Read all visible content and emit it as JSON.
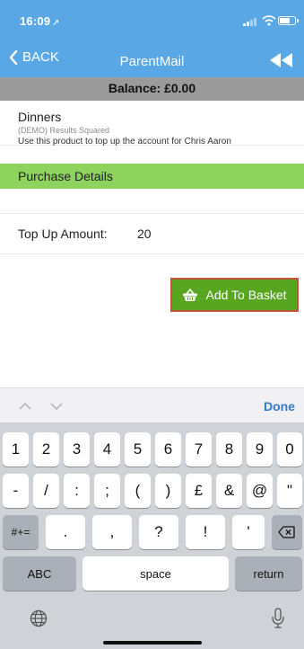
{
  "status_bar": {
    "time": "16:09",
    "location_glyph": "➚"
  },
  "nav": {
    "back_label": "BACK",
    "title": "ParentMail"
  },
  "balance": {
    "text": "Balance: £0.00"
  },
  "product": {
    "name": "Dinners",
    "provider": "(DEMO) Results Squared",
    "description": "Use this product to top up the account for Chris Aaron"
  },
  "purchase": {
    "header": "Purchase Details"
  },
  "topup": {
    "label": "Top Up Amount:",
    "value": "20"
  },
  "basket_button": {
    "label": "Add To Basket"
  },
  "keyboard": {
    "done_label": "Done",
    "row1": [
      "1",
      "2",
      "3",
      "4",
      "5",
      "6",
      "7",
      "8",
      "9",
      "0"
    ],
    "row2": [
      "-",
      "/",
      ":",
      ";",
      "(",
      ")",
      "£",
      "&",
      "@",
      "\""
    ],
    "row3_mode": "#+=",
    "row3": [
      ".",
      ",",
      "?",
      "!",
      "'"
    ],
    "abc_label": "ABC",
    "space_label": "space",
    "return_label": "return"
  },
  "colors": {
    "top_bar": "#5aa7e6",
    "balance_bar": "#9a9a9a",
    "purchase_header": "#8dd35e",
    "basket_button": "#58a51f",
    "basket_border": "#c5523f",
    "done_link": "#2f7ad4"
  }
}
